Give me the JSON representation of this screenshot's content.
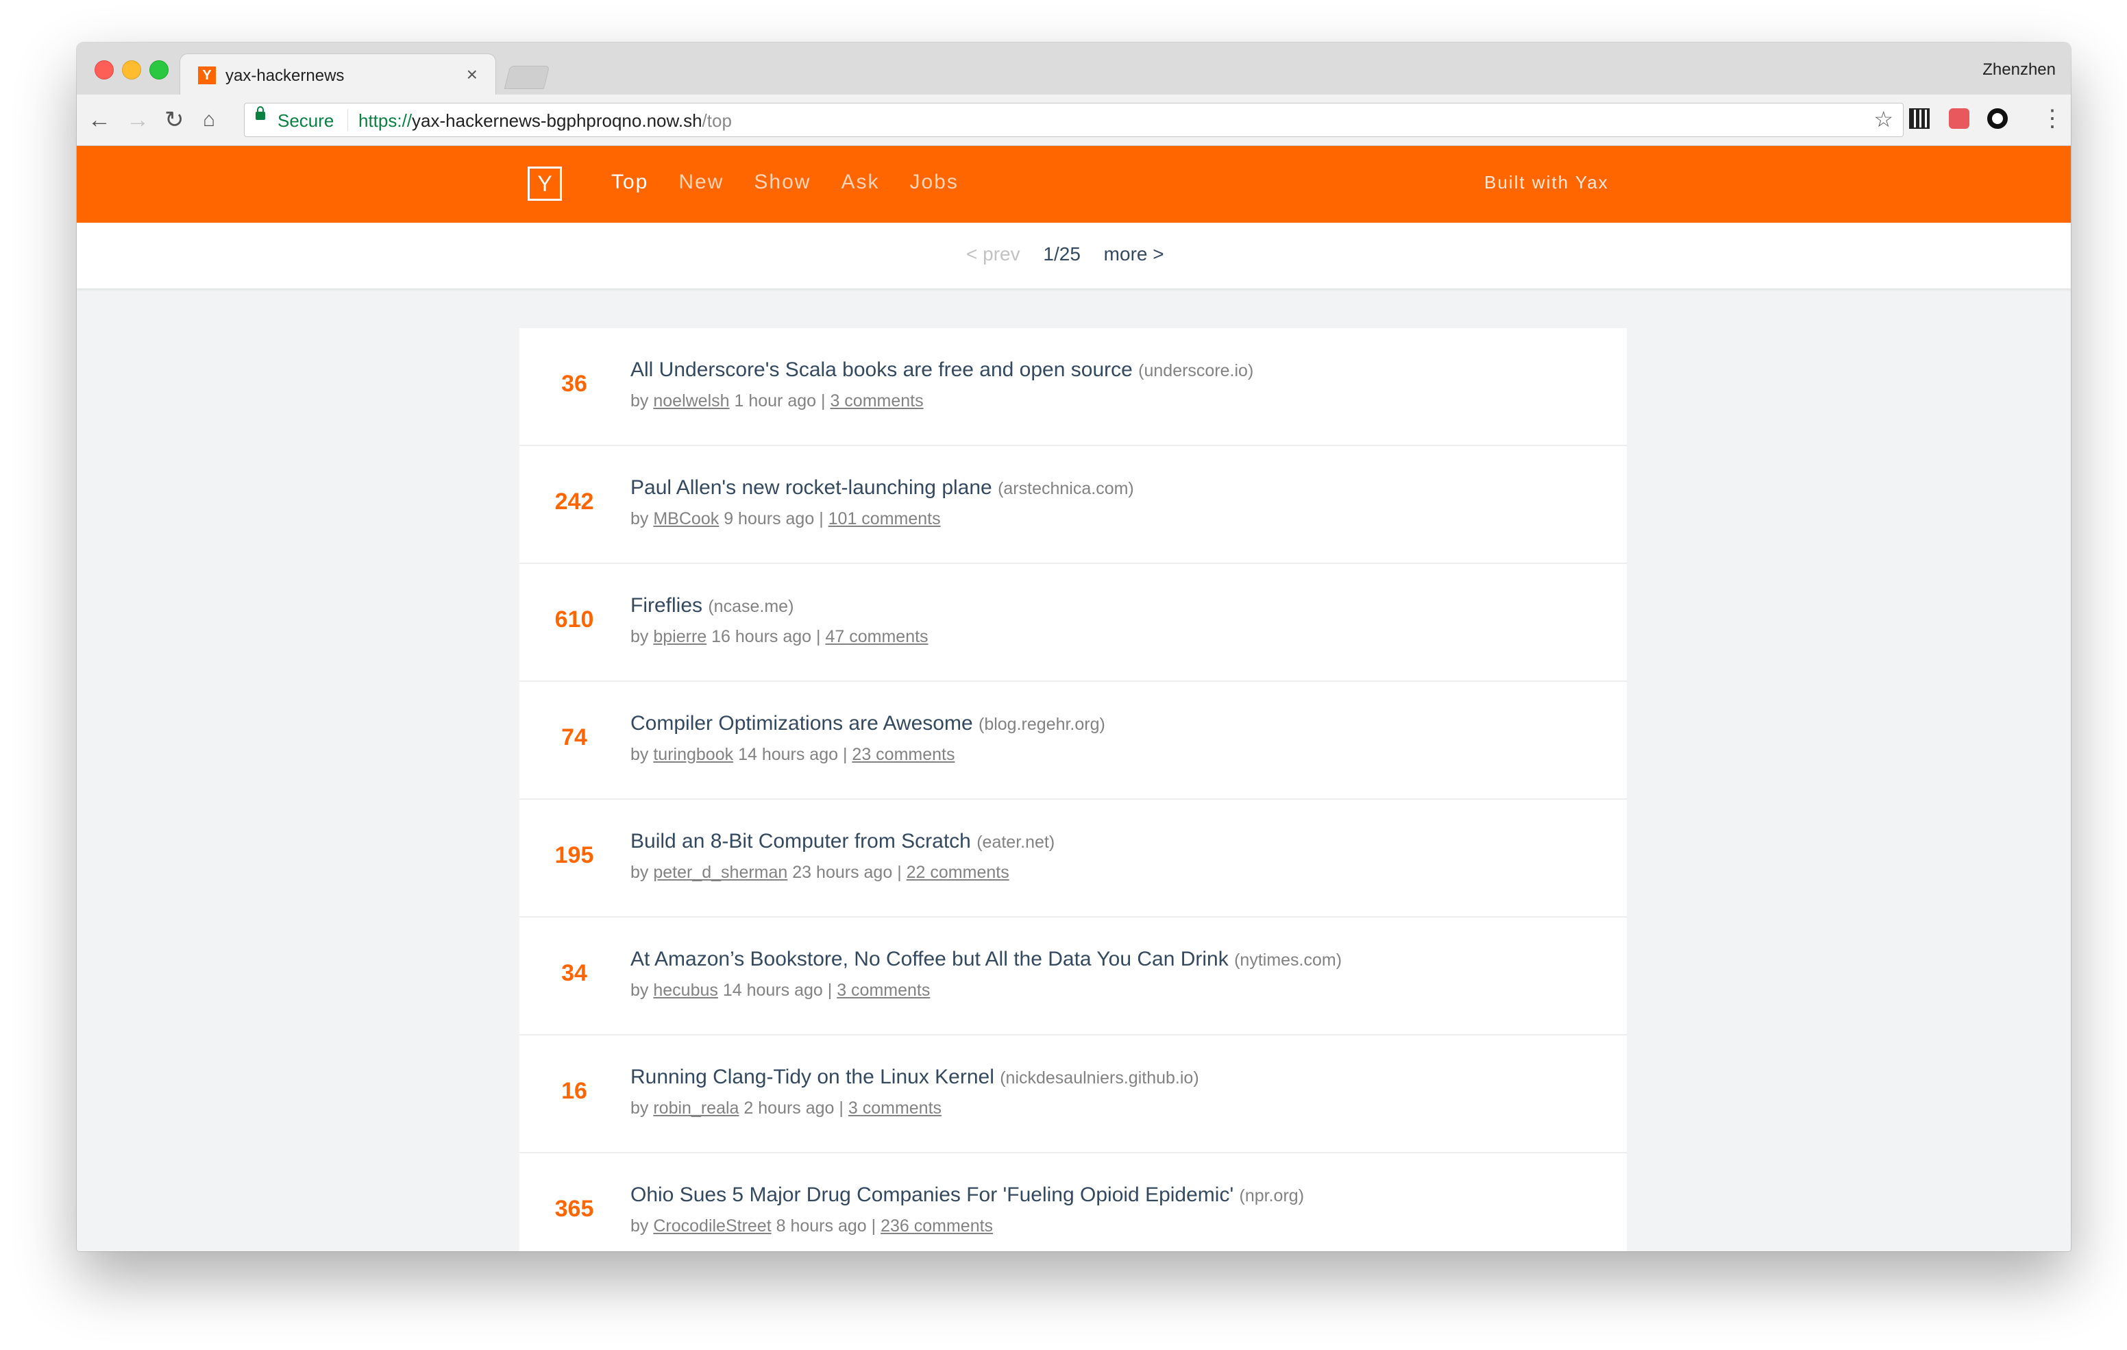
{
  "browser": {
    "tab_title": "yax-hackernews",
    "tab_close": "×",
    "favicon_letter": "Y",
    "profile_name": "Zhenzhen",
    "secure_label": "Secure",
    "url_scheme": "https://",
    "url_host": "yax-hackernews-bgphproqno.now.sh",
    "url_path": "/top"
  },
  "header": {
    "logo": "Y",
    "nav": [
      "Top",
      "New",
      "Show",
      "Ask",
      "Jobs"
    ],
    "active_nav": "Top",
    "built_with": "Built with Yax",
    "brand_color": "#ff6600"
  },
  "pager": {
    "prev": "< prev",
    "page": "1/25",
    "more": "more >"
  },
  "stories": [
    {
      "score": "36",
      "title": "All Underscore's Scala books are free and open source",
      "host": "(underscore.io)",
      "user": "noelwelsh",
      "time": "1 hour ago",
      "comments": "3 comments"
    },
    {
      "score": "242",
      "title": "Paul Allen's new rocket-launching plane",
      "host": "(arstechnica.com)",
      "user": "MBCook",
      "time": "9 hours ago",
      "comments": "101 comments"
    },
    {
      "score": "610",
      "title": "Fireflies",
      "host": "(ncase.me)",
      "user": "bpierre",
      "time": "16 hours ago",
      "comments": "47 comments"
    },
    {
      "score": "74",
      "title": "Compiler Optimizations are Awesome",
      "host": "(blog.regehr.org)",
      "user": "turingbook",
      "time": "14 hours ago",
      "comments": "23 comments"
    },
    {
      "score": "195",
      "title": "Build an 8-Bit Computer from Scratch",
      "host": "(eater.net)",
      "user": "peter_d_sherman",
      "time": "23 hours ago",
      "comments": "22 comments"
    },
    {
      "score": "34",
      "title": "At Amazon’s Bookstore, No Coffee but All the Data You Can Drink",
      "host": "(nytimes.com)",
      "user": "hecubus",
      "time": "14 hours ago",
      "comments": "3 comments"
    },
    {
      "score": "16",
      "title": "Running Clang-Tidy on the Linux Kernel",
      "host": "(nickdesaulniers.github.io)",
      "user": "robin_reala",
      "time": "2 hours ago",
      "comments": "3 comments"
    },
    {
      "score": "365",
      "title": "Ohio Sues 5 Major Drug Companies For 'Fueling Opioid Epidemic'",
      "host": "(npr.org)",
      "user": "CrocodileStreet",
      "time": "8 hours ago",
      "comments": "236 comments"
    }
  ],
  "labels": {
    "by": "by",
    "sep": "|"
  }
}
